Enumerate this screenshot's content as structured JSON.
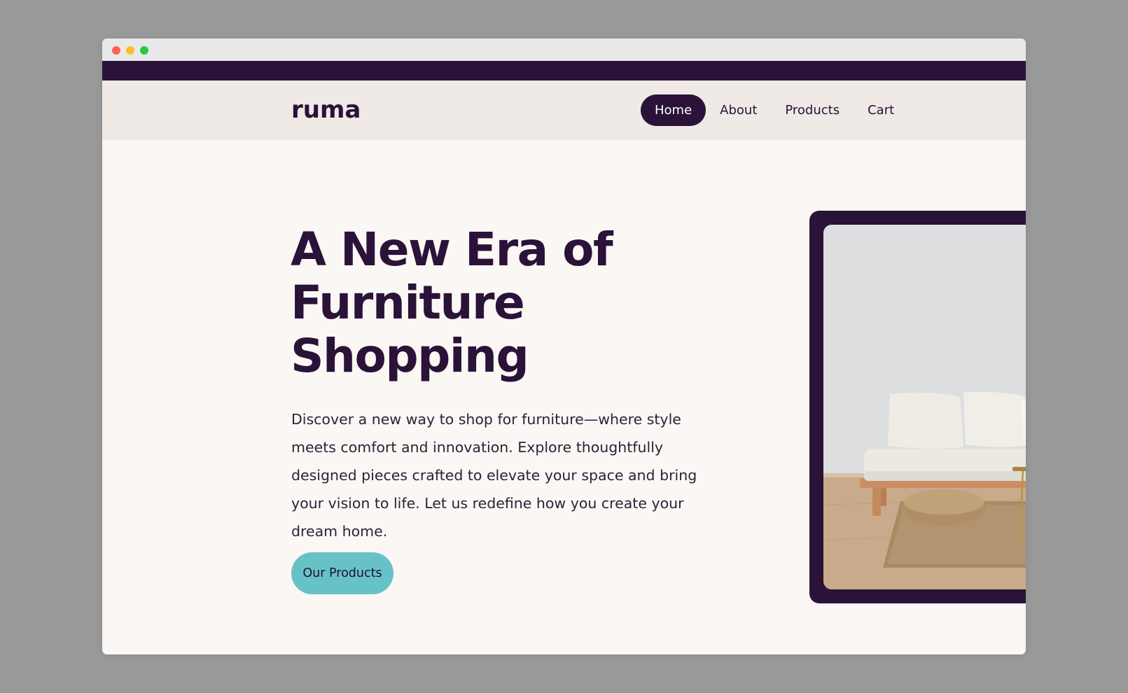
{
  "app": {
    "logo": "ruma"
  },
  "nav": {
    "items": [
      {
        "label": "Home",
        "active": true
      },
      {
        "label": "About",
        "active": false
      },
      {
        "label": "Products",
        "active": false
      },
      {
        "label": "Cart",
        "active": false
      }
    ]
  },
  "hero": {
    "title_line1": "A New Era of",
    "title_line2": "Furniture",
    "title_line3": "Shopping",
    "description": "Discover a new way to shop for furniture—where style meets comfort and innovation. Explore thoughtfully designed pieces crafted to elevate your space and bring your vision to life. Let us redefine how you create your dream home.",
    "cta_label": "Our Products"
  },
  "colors": {
    "primary": "#2a1238",
    "accent": "#67c2c8",
    "background": "#faf7f5",
    "navbar_bg": "#efeae6"
  }
}
